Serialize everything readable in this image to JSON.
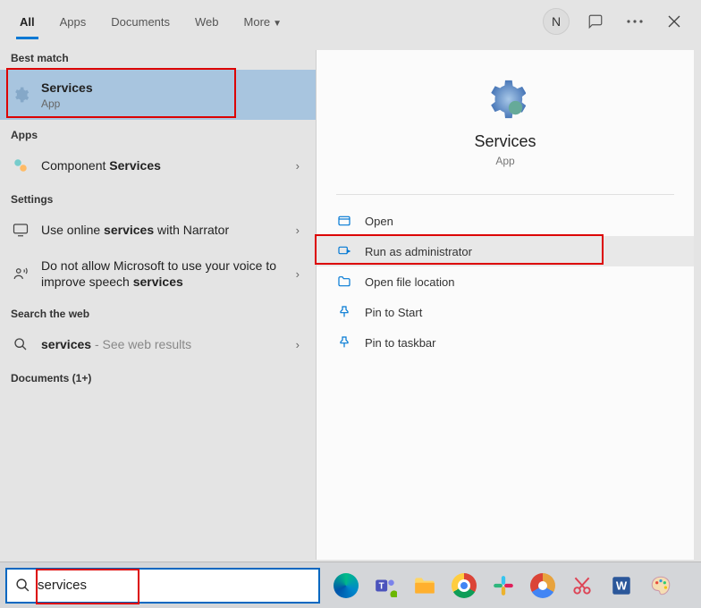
{
  "tabs": {
    "all": "All",
    "apps": "Apps",
    "documents": "Documents",
    "web": "Web",
    "more": "More"
  },
  "avatar_letter": "N",
  "left": {
    "best_match": "Best match",
    "selected": {
      "title": "Services",
      "sub": "App"
    },
    "apps_label": "Apps",
    "apps_item_prefix": "Component ",
    "apps_item_bold": "Services",
    "settings_label": "Settings",
    "setting1_pre": "Use online ",
    "setting1_bold": "services",
    "setting1_post": " with Narrator",
    "setting2_pre": "Do not allow Microsoft to use your voice to improve speech ",
    "setting2_bold": "services",
    "web_label": "Search the web",
    "web_item_bold": "services",
    "web_item_post": " - See web results",
    "docs_label": "Documents (1+)"
  },
  "preview": {
    "title": "Services",
    "sub": "App",
    "actions": {
      "open": "Open",
      "run_admin": "Run as administrator",
      "open_loc": "Open file location",
      "pin_start": "Pin to Start",
      "pin_taskbar": "Pin to taskbar"
    }
  },
  "search": {
    "value": "services"
  }
}
